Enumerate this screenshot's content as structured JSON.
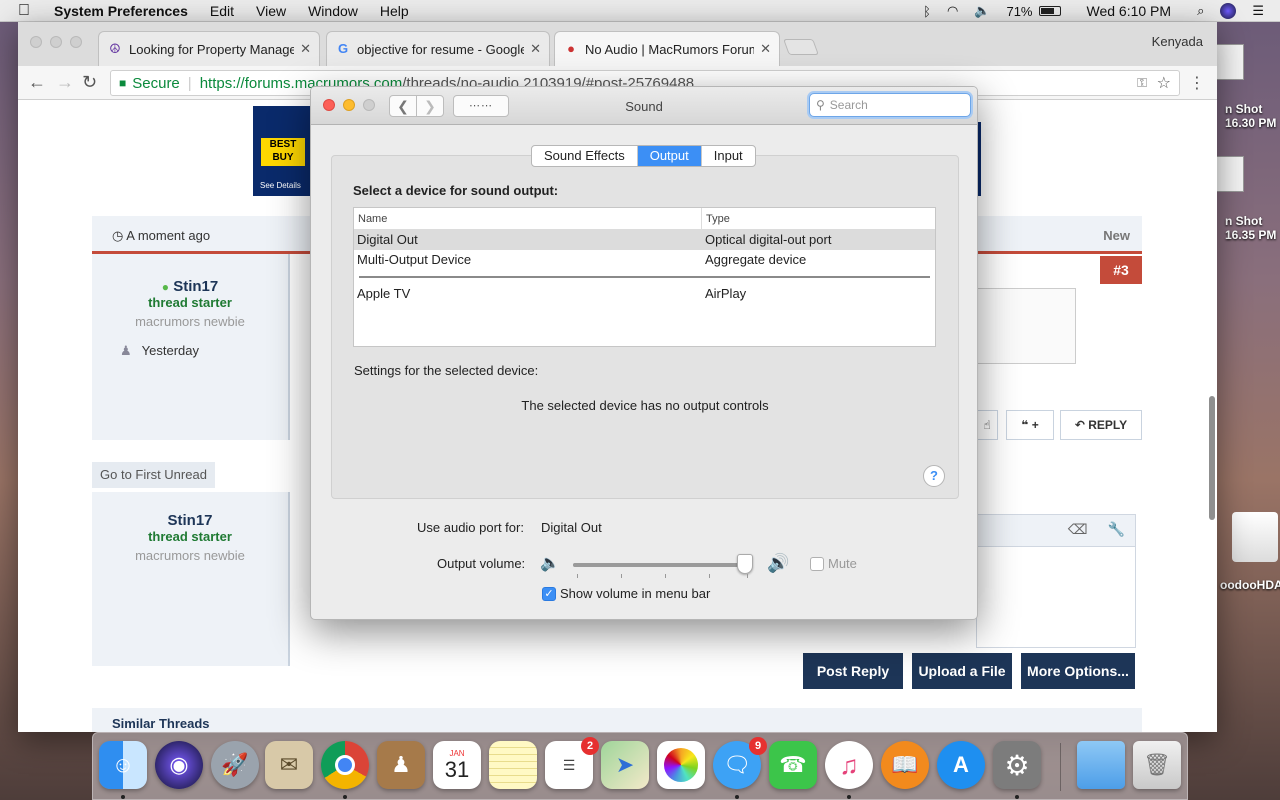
{
  "menubar": {
    "app": "System Preferences",
    "items": [
      "Edit",
      "View",
      "Window",
      "Help"
    ],
    "battery": "71%",
    "clock": "Wed 6:10 PM"
  },
  "desktop": {
    "shot1_line1": "n Shot",
    "shot1_line2": "16.30 PM",
    "shot2_line1": "n Shot",
    "shot2_line2": "16.35 PM",
    "disk_label": "oodooHDA."
  },
  "browser": {
    "tabs": [
      {
        "title": "Looking for Property Manager",
        "favicon": "peace-icon"
      },
      {
        "title": "objective for resume - Google",
        "favicon": "google-icon"
      },
      {
        "title": "No Audio | MacRumors Forums",
        "favicon": "macrumors-icon"
      }
    ],
    "profile": "Kenyada",
    "secure_label": "Secure",
    "url_host": "https://forums.macrumors.com",
    "url_path": "/threads/no-audio.2103919/#post-25769488"
  },
  "forum": {
    "ad_logo": "BEST BUY",
    "ad_see": "See Details",
    "timestamp": "A moment ago",
    "new_label": "New",
    "post_number": "#3",
    "user1": {
      "name": "Stin17",
      "role": "thread starter",
      "rank": "macrumors newbie",
      "joined": "Yesterday"
    },
    "user2": {
      "name": "Stin17",
      "role": "thread starter",
      "rank": "macrumors newbie"
    },
    "like_label": "+",
    "reply_label": "REPLY",
    "go_first_unread": "Go to First Unread",
    "post_reply": "Post Reply",
    "upload_file": "Upload a File",
    "more_options": "More Options...",
    "similar_threads": "Similar Threads"
  },
  "sound": {
    "title": "Sound",
    "search_placeholder": "Search",
    "tabs": [
      "Sound Effects",
      "Output",
      "Input"
    ],
    "active_tab": "Output",
    "select_label": "Select a device for sound output:",
    "columns": {
      "name": "Name",
      "type": "Type"
    },
    "devices": [
      {
        "name": "Digital Out",
        "type": "Optical digital-out port"
      },
      {
        "name": "Multi-Output Device",
        "type": "Aggregate device"
      },
      {
        "name": "Apple TV",
        "type": "AirPlay"
      }
    ],
    "settings_label": "Settings for the selected device:",
    "no_controls": "The selected device has no output controls",
    "help": "?",
    "audio_port_label": "Use audio port for:",
    "audio_port_value": "Digital Out",
    "volume_label": "Output volume:",
    "volume_level": 0.98,
    "mute_label": "Mute",
    "mute_checked": false,
    "show_volume_label": "Show volume in menu bar",
    "show_volume_checked": true
  },
  "dock": {
    "calendar_month": "JAN",
    "calendar_day": "31",
    "reminders_badge": "2",
    "messages_badge": "9"
  },
  "colors": {
    "accent": "#3c8ff5",
    "forum_red": "#c44b3a",
    "forum_navy": "#1d3557",
    "forum_green": "#1f7a33"
  }
}
